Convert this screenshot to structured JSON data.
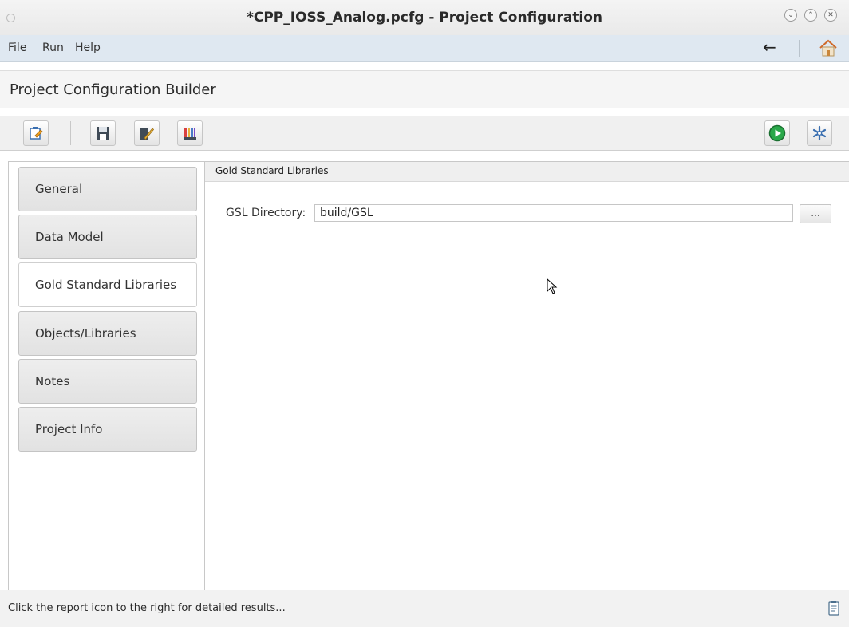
{
  "window": {
    "title": "*CPP_IOSS_Analog.pcfg - Project Configuration",
    "controls": [
      "minimize",
      "maximize",
      "close"
    ]
  },
  "menubar": {
    "items": [
      "File",
      "Run",
      "Help"
    ],
    "back_icon": "←",
    "home_icon": "home-icon"
  },
  "header": {
    "title": "Project Configuration Builder"
  },
  "toolbar": {
    "left_buttons": [
      "edit-config-icon",
      "save-icon",
      "edit-pencil-icon",
      "library-books-icon"
    ],
    "right_buttons": [
      "run-icon",
      "settings-snowflake-icon"
    ]
  },
  "sidebar": {
    "items": [
      {
        "label": "General",
        "active": false
      },
      {
        "label": "Data Model",
        "active": false
      },
      {
        "label": "Gold Standard Libraries",
        "active": true
      },
      {
        "label": "Objects/Libraries",
        "active": false
      },
      {
        "label": "Notes",
        "active": false
      },
      {
        "label": "Project Info",
        "active": false
      }
    ]
  },
  "main": {
    "section_title": "Gold Standard Libraries",
    "gsl_label": "GSL Directory:",
    "gsl_value": "build/GSL",
    "browse_label": "..."
  },
  "status": {
    "text": "Click the report icon to the right for detailed results...",
    "report_icon": "report-clipboard-icon"
  },
  "colors": {
    "menubar_bg": "#dfe8f1",
    "run_green": "#2aa84a",
    "settings_blue": "#3a6fb0"
  }
}
